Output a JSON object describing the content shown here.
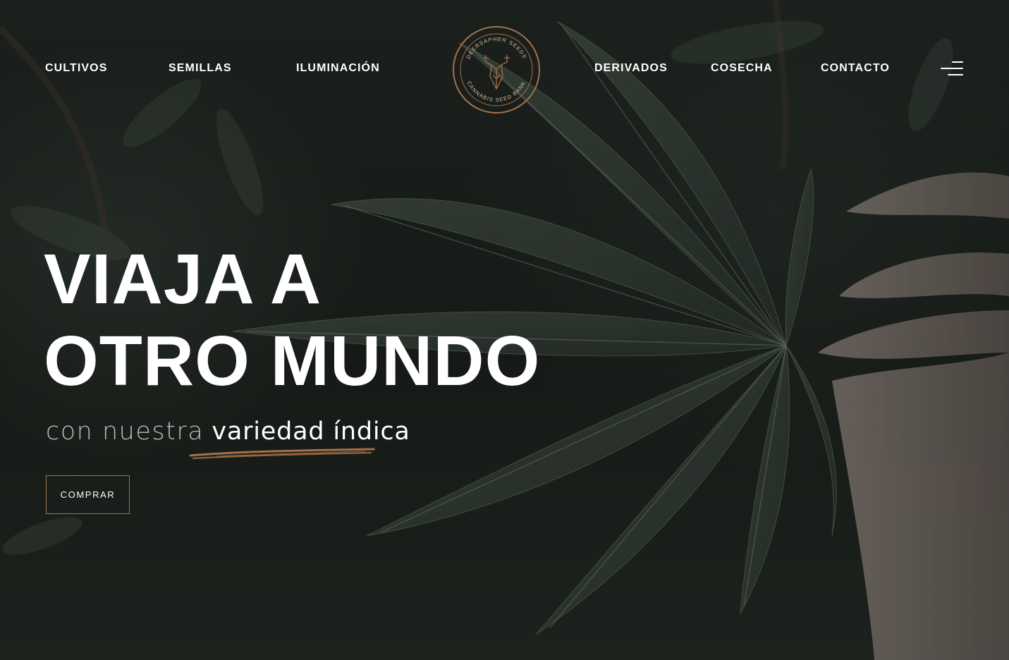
{
  "nav": {
    "left_items": [
      {
        "label": "CULTIVOS"
      },
      {
        "label": "SEMILLAS"
      },
      {
        "label": "ILUMINACIÓN"
      }
    ],
    "right_items": [
      {
        "label": "DERIVADOS"
      },
      {
        "label": "COSECHA"
      },
      {
        "label": "CONTACTO"
      }
    ],
    "menu_icon": "hamburger-menu-icon"
  },
  "logo": {
    "top_text": "DEERSAPHER SEEDS",
    "bottom_text": "CANNABIS SEED BANK",
    "icon": "deer-head-logo"
  },
  "hero": {
    "title_line1": "VIAJA A",
    "title_line2": "OTRO MUNDO",
    "subtitle_light": "con nuestra",
    "subtitle_strong": "variedad índica",
    "button_label": "COMPRAR"
  },
  "colors": {
    "accent": "#a47149",
    "text": "#ffffff",
    "background": "#1e231f",
    "leaf": "#3f4a42"
  }
}
